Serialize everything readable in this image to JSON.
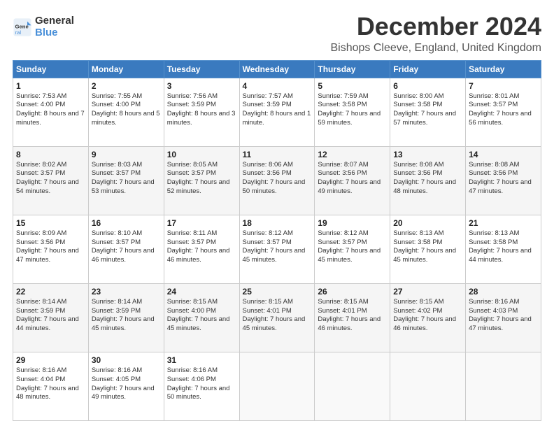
{
  "logo": {
    "line1": "General",
    "line2": "Blue"
  },
  "title": "December 2024",
  "location": "Bishops Cleeve, England, United Kingdom",
  "days_header": [
    "Sunday",
    "Monday",
    "Tuesday",
    "Wednesday",
    "Thursday",
    "Friday",
    "Saturday"
  ],
  "weeks": [
    [
      {
        "num": "1",
        "sunrise": "7:53 AM",
        "sunset": "4:00 PM",
        "daylight": "8 hours and 7 minutes."
      },
      {
        "num": "2",
        "sunrise": "7:55 AM",
        "sunset": "4:00 PM",
        "daylight": "8 hours and 5 minutes."
      },
      {
        "num": "3",
        "sunrise": "7:56 AM",
        "sunset": "3:59 PM",
        "daylight": "8 hours and 3 minutes."
      },
      {
        "num": "4",
        "sunrise": "7:57 AM",
        "sunset": "3:59 PM",
        "daylight": "8 hours and 1 minute."
      },
      {
        "num": "5",
        "sunrise": "7:59 AM",
        "sunset": "3:58 PM",
        "daylight": "7 hours and 59 minutes."
      },
      {
        "num": "6",
        "sunrise": "8:00 AM",
        "sunset": "3:58 PM",
        "daylight": "7 hours and 57 minutes."
      },
      {
        "num": "7",
        "sunrise": "8:01 AM",
        "sunset": "3:57 PM",
        "daylight": "7 hours and 56 minutes."
      }
    ],
    [
      {
        "num": "8",
        "sunrise": "8:02 AM",
        "sunset": "3:57 PM",
        "daylight": "7 hours and 54 minutes."
      },
      {
        "num": "9",
        "sunrise": "8:03 AM",
        "sunset": "3:57 PM",
        "daylight": "7 hours and 53 minutes."
      },
      {
        "num": "10",
        "sunrise": "8:05 AM",
        "sunset": "3:57 PM",
        "daylight": "7 hours and 52 minutes."
      },
      {
        "num": "11",
        "sunrise": "8:06 AM",
        "sunset": "3:56 PM",
        "daylight": "7 hours and 50 minutes."
      },
      {
        "num": "12",
        "sunrise": "8:07 AM",
        "sunset": "3:56 PM",
        "daylight": "7 hours and 49 minutes."
      },
      {
        "num": "13",
        "sunrise": "8:08 AM",
        "sunset": "3:56 PM",
        "daylight": "7 hours and 48 minutes."
      },
      {
        "num": "14",
        "sunrise": "8:08 AM",
        "sunset": "3:56 PM",
        "daylight": "7 hours and 47 minutes."
      }
    ],
    [
      {
        "num": "15",
        "sunrise": "8:09 AM",
        "sunset": "3:56 PM",
        "daylight": "7 hours and 47 minutes."
      },
      {
        "num": "16",
        "sunrise": "8:10 AM",
        "sunset": "3:57 PM",
        "daylight": "7 hours and 46 minutes."
      },
      {
        "num": "17",
        "sunrise": "8:11 AM",
        "sunset": "3:57 PM",
        "daylight": "7 hours and 46 minutes."
      },
      {
        "num": "18",
        "sunrise": "8:12 AM",
        "sunset": "3:57 PM",
        "daylight": "7 hours and 45 minutes."
      },
      {
        "num": "19",
        "sunrise": "8:12 AM",
        "sunset": "3:57 PM",
        "daylight": "7 hours and 45 minutes."
      },
      {
        "num": "20",
        "sunrise": "8:13 AM",
        "sunset": "3:58 PM",
        "daylight": "7 hours and 45 minutes."
      },
      {
        "num": "21",
        "sunrise": "8:13 AM",
        "sunset": "3:58 PM",
        "daylight": "7 hours and 44 minutes."
      }
    ],
    [
      {
        "num": "22",
        "sunrise": "8:14 AM",
        "sunset": "3:59 PM",
        "daylight": "7 hours and 44 minutes."
      },
      {
        "num": "23",
        "sunrise": "8:14 AM",
        "sunset": "3:59 PM",
        "daylight": "7 hours and 45 minutes."
      },
      {
        "num": "24",
        "sunrise": "8:15 AM",
        "sunset": "4:00 PM",
        "daylight": "7 hours and 45 minutes."
      },
      {
        "num": "25",
        "sunrise": "8:15 AM",
        "sunset": "4:01 PM",
        "daylight": "7 hours and 45 minutes."
      },
      {
        "num": "26",
        "sunrise": "8:15 AM",
        "sunset": "4:01 PM",
        "daylight": "7 hours and 46 minutes."
      },
      {
        "num": "27",
        "sunrise": "8:15 AM",
        "sunset": "4:02 PM",
        "daylight": "7 hours and 46 minutes."
      },
      {
        "num": "28",
        "sunrise": "8:16 AM",
        "sunset": "4:03 PM",
        "daylight": "7 hours and 47 minutes."
      }
    ],
    [
      {
        "num": "29",
        "sunrise": "8:16 AM",
        "sunset": "4:04 PM",
        "daylight": "7 hours and 48 minutes."
      },
      {
        "num": "30",
        "sunrise": "8:16 AM",
        "sunset": "4:05 PM",
        "daylight": "7 hours and 49 minutes."
      },
      {
        "num": "31",
        "sunrise": "8:16 AM",
        "sunset": "4:06 PM",
        "daylight": "7 hours and 50 minutes."
      },
      null,
      null,
      null,
      null
    ]
  ]
}
